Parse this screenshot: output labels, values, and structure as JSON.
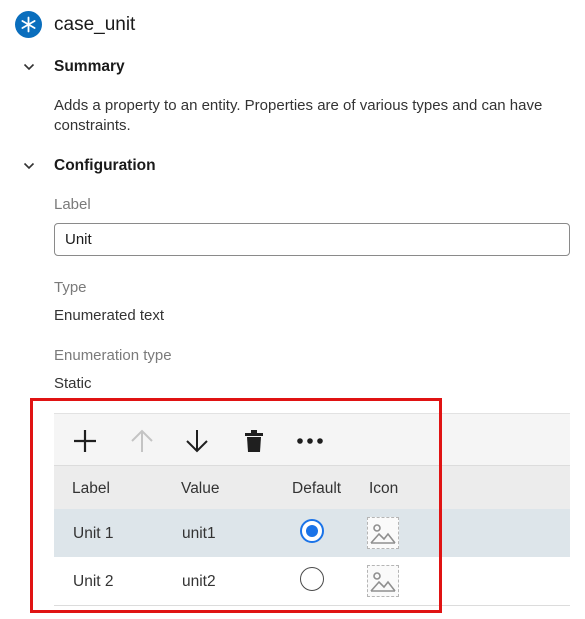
{
  "header": {
    "title": "case_unit",
    "icon": "asterisk-icon",
    "icon_color": "#0a6ebd"
  },
  "summary": {
    "title": "Summary",
    "description": "Adds a property to an entity. Properties are of various types and can have constraints."
  },
  "configuration": {
    "title": "Configuration",
    "label_caption": "Label",
    "label_value": "Unit",
    "type_caption": "Type",
    "type_value": "Enumerated text",
    "enum_type_caption": "Enumeration type",
    "enum_type_value": "Static"
  },
  "toolbar": {
    "buttons": [
      {
        "icon": "plus-icon",
        "enabled": true
      },
      {
        "icon": "arrow-up-icon",
        "enabled": false
      },
      {
        "icon": "arrow-down-icon",
        "enabled": true
      },
      {
        "icon": "trash-icon",
        "enabled": true
      },
      {
        "icon": "more-icon",
        "enabled": true
      }
    ]
  },
  "table": {
    "columns": [
      "Label",
      "Value",
      "Default",
      "Icon"
    ],
    "rows": [
      {
        "label": "Unit 1",
        "value": "unit1",
        "default": true,
        "selected": true
      },
      {
        "label": "Unit 2",
        "value": "unit2",
        "default": false,
        "selected": false
      }
    ]
  },
  "colors": {
    "accent": "#1a73e8",
    "selected_row": "#dde5ea",
    "highlight": "#e01313"
  }
}
